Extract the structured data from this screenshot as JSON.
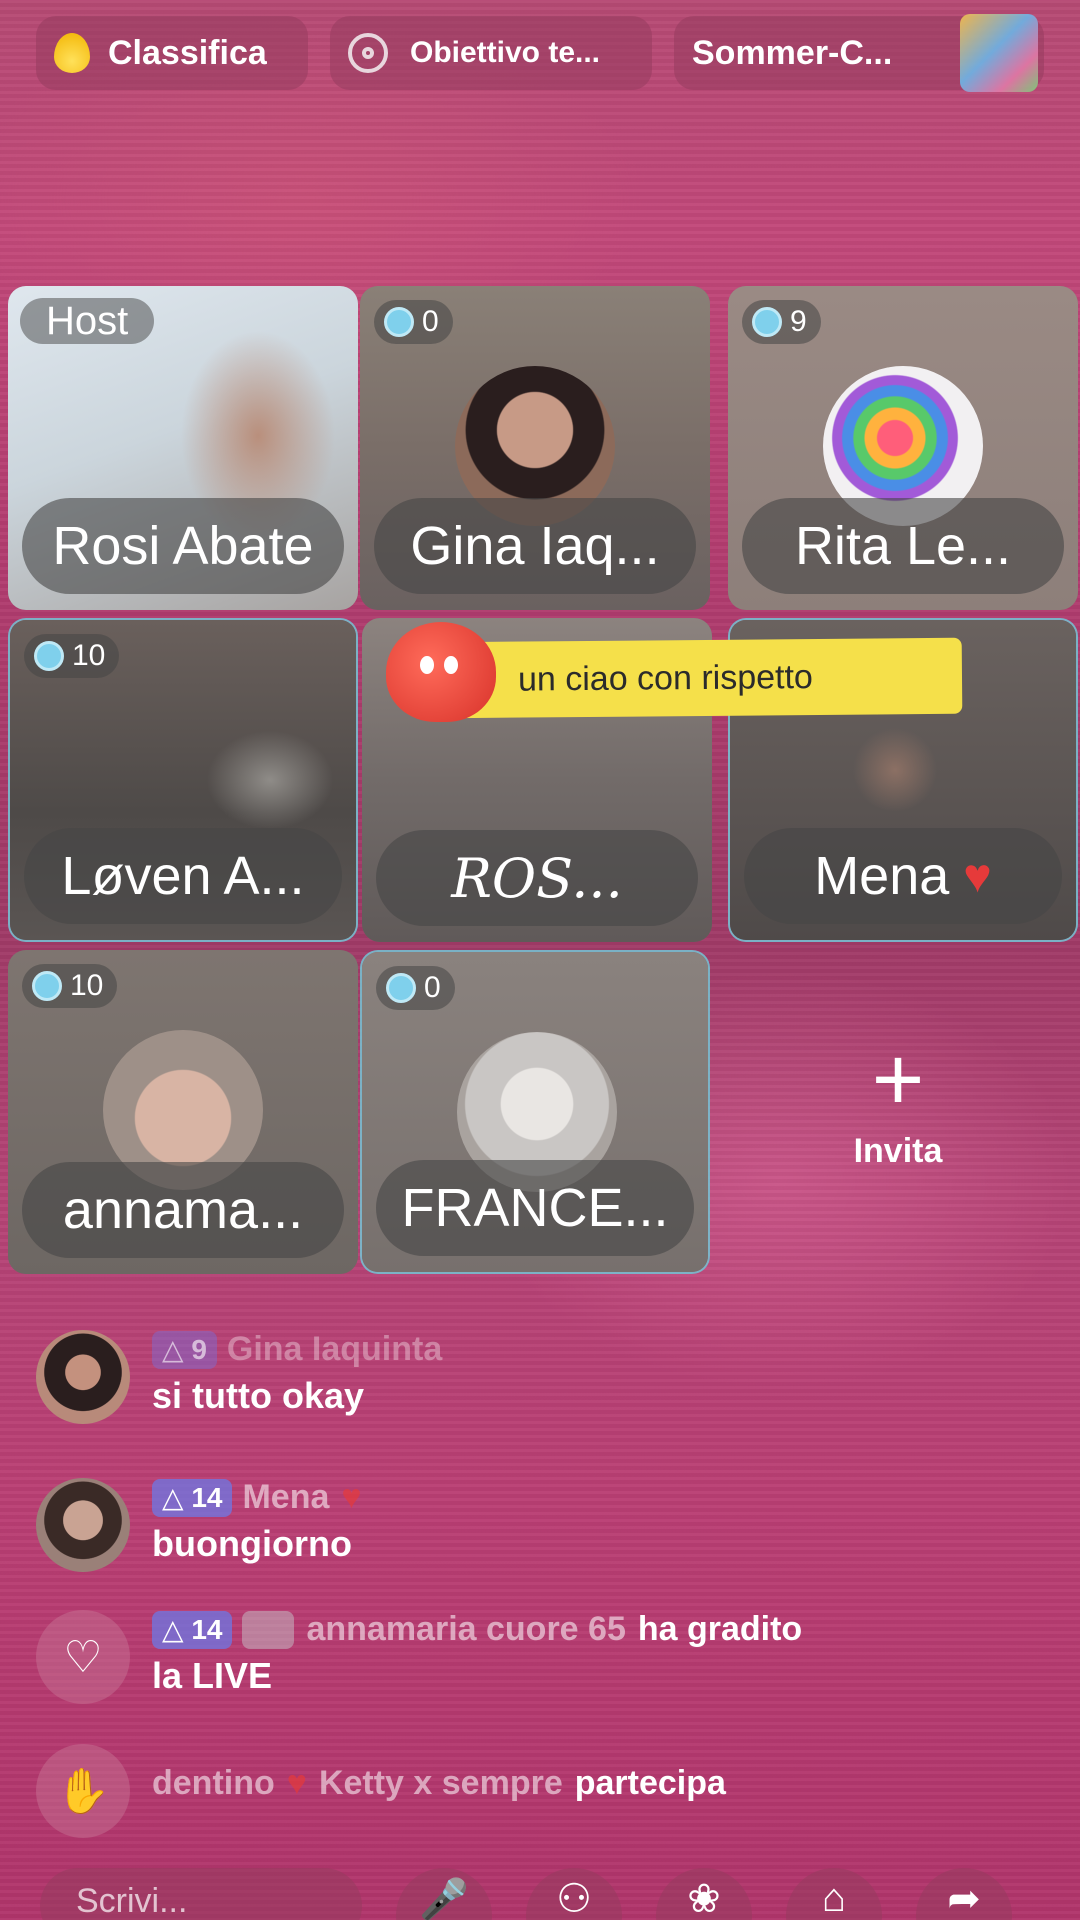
{
  "topbar": {
    "ranking_label": "Classifica",
    "goal_label": "Obiettivo te...",
    "event_label": "Sommer-C..."
  },
  "grid": {
    "host_tag": "Host",
    "tiles": [
      {
        "name": "Rosi Abate",
        "badge": ""
      },
      {
        "name": "Gina Iaq...",
        "badge": "0"
      },
      {
        "name": "Rita Le...",
        "badge": "9"
      },
      {
        "name": "Løven A...",
        "badge": "10"
      },
      {
        "name": "ROS...",
        "badge": ""
      },
      {
        "name": "Mena",
        "badge": ""
      },
      {
        "name": "annama...",
        "badge": "10"
      },
      {
        "name": "FRANCE...",
        "badge": "0"
      }
    ],
    "invite_label": "Invita",
    "banner_text": "un ciao con rispetto"
  },
  "chat": [
    {
      "level": "9",
      "user": "Gina Iaquinta",
      "text": "si tutto okay"
    },
    {
      "level": "14",
      "user": "Mena",
      "text": "buongiorno"
    },
    {
      "level": "14",
      "user": "annamaria cuore 65",
      "action": "ha gradito",
      "text": "la LIVE"
    },
    {
      "user": "dentino",
      "user2": "Ketty x sempre",
      "action": "partecipa"
    }
  ],
  "bottombar": {
    "compose_placeholder": "Scrivi..."
  },
  "colors": {
    "background": "#b23c6f",
    "banner": "#f5e04a",
    "level_badge": "#6e78e6"
  }
}
